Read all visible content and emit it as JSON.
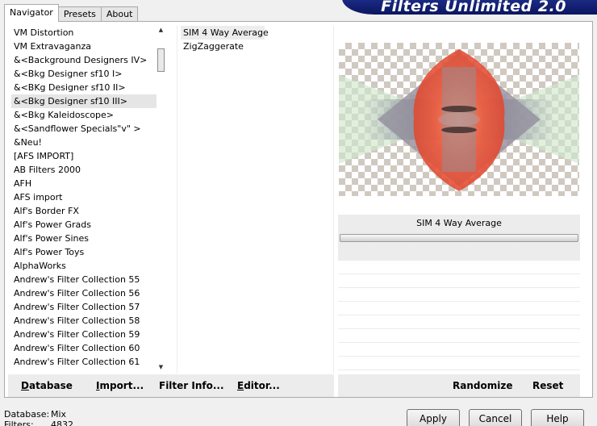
{
  "tabs": [
    "Navigator",
    "Presets",
    "About"
  ],
  "banner_title": "Filters Unlimited 2.0",
  "categories": [
    "VM Distortion",
    "VM Extravaganza",
    "&<Background Designers IV>",
    "&<Bkg Designer sf10 I>",
    "&<BKg Designer sf10 II>",
    "&<Bkg Designer sf10 III>",
    "&<Bkg Kaleidoscope>",
    "&<Sandflower Specials\"v\" >",
    "&Neu!",
    "[AFS IMPORT]",
    "AB Filters 2000",
    "AFH",
    "AFS import",
    "Alf's Border FX",
    "Alf's Power Grads",
    "Alf's Power Sines",
    "Alf's Power Toys",
    "AlphaWorks",
    "Andrew's Filter Collection 55",
    "Andrew's Filter Collection 56",
    "Andrew's Filter Collection 57",
    "Andrew's Filter Collection 58",
    "Andrew's Filter Collection 59",
    "Andrew's Filter Collection 60",
    "Andrew's Filter Collection 61"
  ],
  "filters": [
    "SIM 4 Way Average",
    "ZigZaggerate"
  ],
  "selected_filter_title": "SIM 4 Way Average",
  "left_buttons": {
    "database": "Database",
    "import": "Import...",
    "filter_info": "Filter Info...",
    "editor": "Editor..."
  },
  "right_buttons": {
    "randomize": "Randomize",
    "reset": "Reset"
  },
  "status": {
    "database_label": "Database:",
    "database_value": "Mix",
    "filters_label": "Filters:",
    "filters_value": "4832"
  },
  "dialog_buttons": {
    "apply": "Apply",
    "cancel": "Cancel",
    "help": "Help"
  }
}
